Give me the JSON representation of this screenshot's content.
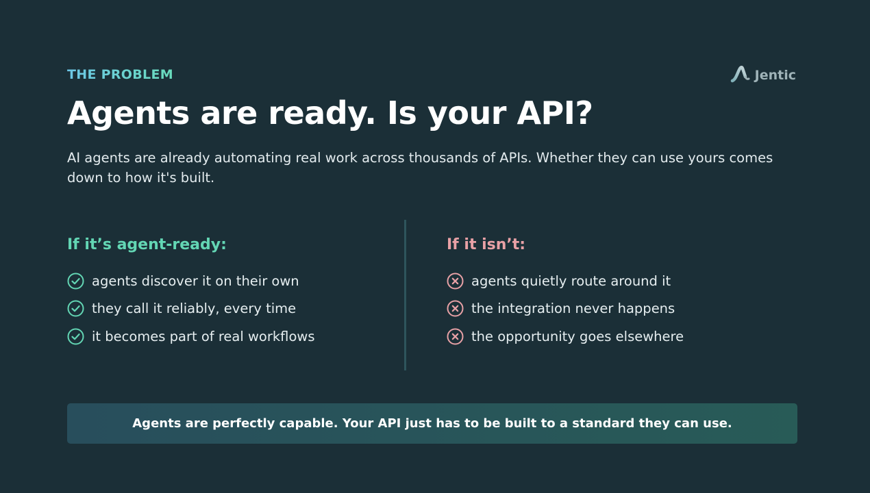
{
  "header": {
    "eyebrow": "THE PROBLEM",
    "brand": "Jentic",
    "brand_logo_icon": "jentic-logo-icon"
  },
  "title": "Agents are ready. Is your API?",
  "intro": "AI agents are already automating real work across thousands of APIs. Whether they can use yours comes down to how it's built.",
  "left": {
    "heading": "If it’s agent-ready:",
    "icon": "check-circle-icon",
    "items": [
      {
        "label": "agents discover it on their own"
      },
      {
        "label": "they call it reliably, every time"
      },
      {
        "label": "it becomes part of real workflows"
      }
    ]
  },
  "right": {
    "heading": "If it isn’t:",
    "icon": "x-circle-icon",
    "items": [
      {
        "label": "agents quietly route around it"
      },
      {
        "label": "the integration never happens"
      },
      {
        "label": "the opportunity goes elsewhere"
      }
    ]
  },
  "banner": {
    "text": "Agents are perfectly capable. Your API just has to be built to a standard they can use."
  },
  "colors": {
    "background": "#1b2f37",
    "positive": "#63d6b4",
    "negative": "#e8a1a6",
    "eyebrow_start": "#6cc6e6",
    "eyebrow_end": "#69dcbc"
  }
}
